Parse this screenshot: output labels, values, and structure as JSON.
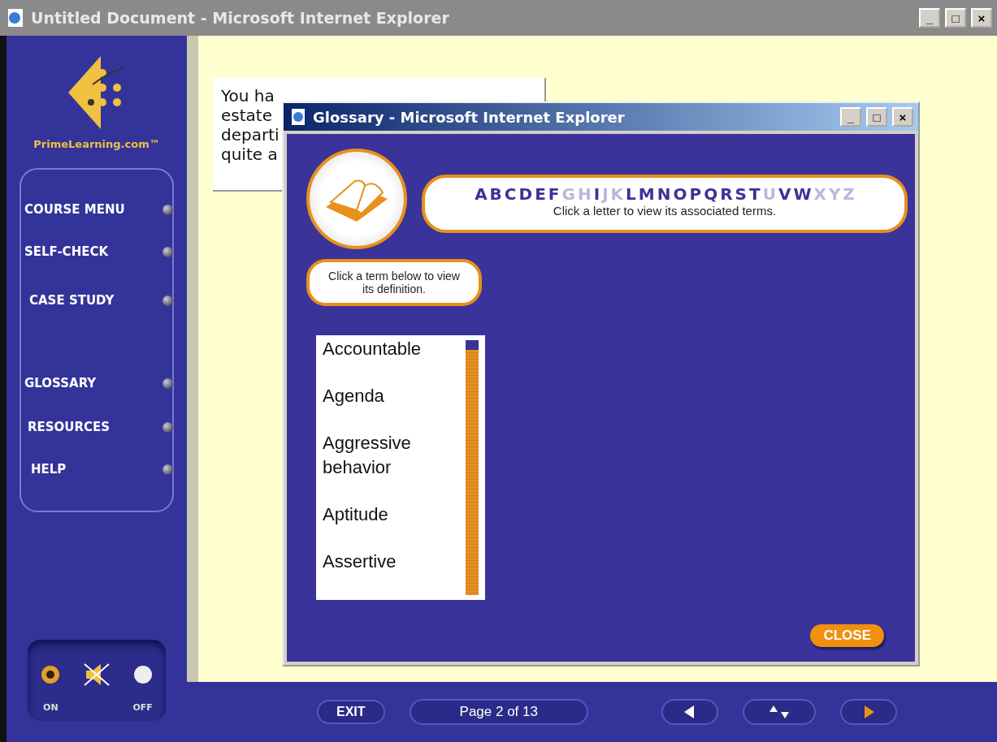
{
  "window": {
    "title": "Untitled Document - Microsoft Internet Explorer",
    "controls": [
      "_",
      "□",
      "×"
    ]
  },
  "sidebar": {
    "brand": "PrimeLearning.com™",
    "items": [
      {
        "label": "COURSE MENU"
      },
      {
        "label": "SELF-CHECK"
      },
      {
        "label": "CASE STUDY"
      },
      {
        "label": "GLOSSARY"
      },
      {
        "label": "RESOURCES"
      },
      {
        "label": "HELP"
      }
    ],
    "sound": {
      "on_label": "ON",
      "off_label": "OFF",
      "on": true
    }
  },
  "content": {
    "lines": [
      "You ha",
      "estate",
      "departi",
      "quite a"
    ]
  },
  "glossary": {
    "title": "Glossary - Microsoft Internet Explorer",
    "controls": [
      "_",
      "□",
      "×"
    ],
    "letters": [
      {
        "letter": "A",
        "available": true
      },
      {
        "letter": "B",
        "available": true
      },
      {
        "letter": "C",
        "available": true
      },
      {
        "letter": "D",
        "available": true
      },
      {
        "letter": "E",
        "available": true
      },
      {
        "letter": "F",
        "available": true
      },
      {
        "letter": "G",
        "available": false
      },
      {
        "letter": "H",
        "available": false
      },
      {
        "letter": "I",
        "available": true
      },
      {
        "letter": "J",
        "available": false
      },
      {
        "letter": "K",
        "available": false
      },
      {
        "letter": "L",
        "available": true
      },
      {
        "letter": "M",
        "available": true
      },
      {
        "letter": "N",
        "available": true
      },
      {
        "letter": "O",
        "available": true
      },
      {
        "letter": "P",
        "available": true
      },
      {
        "letter": "Q",
        "available": true
      },
      {
        "letter": "R",
        "available": true
      },
      {
        "letter": "S",
        "available": true
      },
      {
        "letter": "T",
        "available": true
      },
      {
        "letter": "U",
        "available": false
      },
      {
        "letter": "V",
        "available": true
      },
      {
        "letter": "W",
        "available": true
      },
      {
        "letter": "X",
        "available": false
      },
      {
        "letter": "Y",
        "available": false
      },
      {
        "letter": "Z",
        "available": false
      }
    ],
    "letter_hint": "Click a letter to view its associated terms.",
    "term_hint": "Click a term below to view its definition.",
    "terms": [
      "Accountable",
      "Agenda",
      "Aggressive behavior",
      "Aptitude",
      "Assertive"
    ],
    "close": "CLOSE"
  },
  "footer": {
    "exit": "EXIT",
    "page": "Page 2 of 13"
  }
}
